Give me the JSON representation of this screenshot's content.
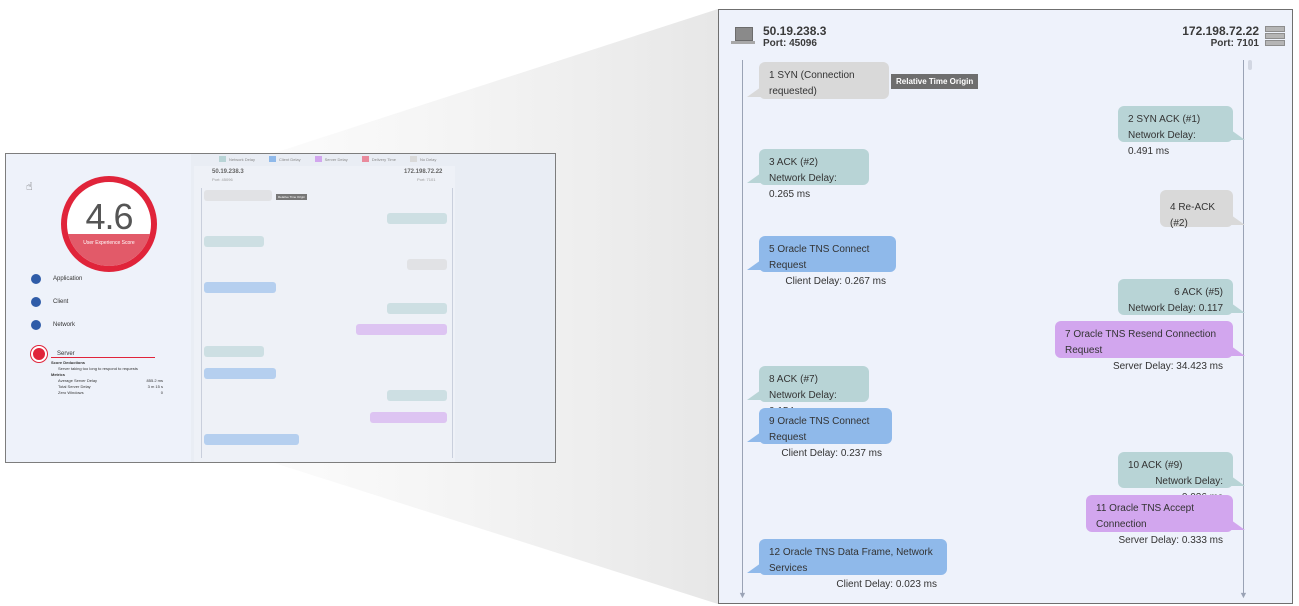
{
  "thumbnail": {
    "score": "4.6",
    "score_label": "User Experience Score",
    "categories": [
      "Application",
      "Client",
      "Network",
      "Server"
    ],
    "score_deductions_title": "Score Deductions",
    "deduction": "Server taking too long to respond to requests",
    "metrics_title": "Metrics",
    "metrics": [
      {
        "label": "Average Server Delay",
        "value": "855.2 ms"
      },
      {
        "label": "Total Server Delay",
        "value": "3 m 15 s"
      },
      {
        "label": "Zero Windows",
        "value": "0"
      }
    ],
    "legend": [
      "Network Delay",
      "Client Delay",
      "Server Delay",
      "Delivery Time",
      "No Delay"
    ]
  },
  "colors": {
    "network": "#b8d4d6",
    "client": "#8fb9ea",
    "server": "#d2a6ee",
    "delivery": "#e98a9c",
    "none": "#d9d9d9",
    "score_ring": "#e0243a"
  },
  "main": {
    "client_host": "50.19.238.3",
    "client_port": "Port: 45096",
    "server_host": "172.198.72.22",
    "server_port": "Port: 7101",
    "relative_time_tag": "Relative Time Origin",
    "messages": [
      {
        "line1": "1  SYN (Connection requested)",
        "line2": ""
      },
      {
        "line1": "2  SYN ACK (#1)",
        "line2": "Network Delay:  0.491 ms"
      },
      {
        "line1": "3  ACK (#2)",
        "line2": "Network Delay:  0.265 ms"
      },
      {
        "line1": "4  Re-ACK (#2)",
        "line2": ""
      },
      {
        "line1": "5  Oracle TNS Connect Request",
        "line2": "Client Delay:  0.267 ms"
      },
      {
        "line1": "6  ACK (#5)",
        "line2": "Network Delay:  0.117 ms"
      },
      {
        "line1": "7  Oracle TNS Resend Connection Request",
        "line2": "Server Delay:  34.423 ms"
      },
      {
        "line1": "8  ACK (#7)",
        "line2": "Network Delay:  0.154 ms"
      },
      {
        "line1": "9  Oracle TNS Connect Request",
        "line2": "Client Delay:  0.237 ms"
      },
      {
        "line1": "10  ACK (#9)",
        "line2": "Network Delay:  0.026 ms"
      },
      {
        "line1": "11  Oracle TNS Accept Connection",
        "line2": "Server Delay:  0.333 ms"
      },
      {
        "line1": "12  Oracle TNS Data Frame, Network Services",
        "line2": "Client Delay:  0.023 ms"
      }
    ]
  }
}
